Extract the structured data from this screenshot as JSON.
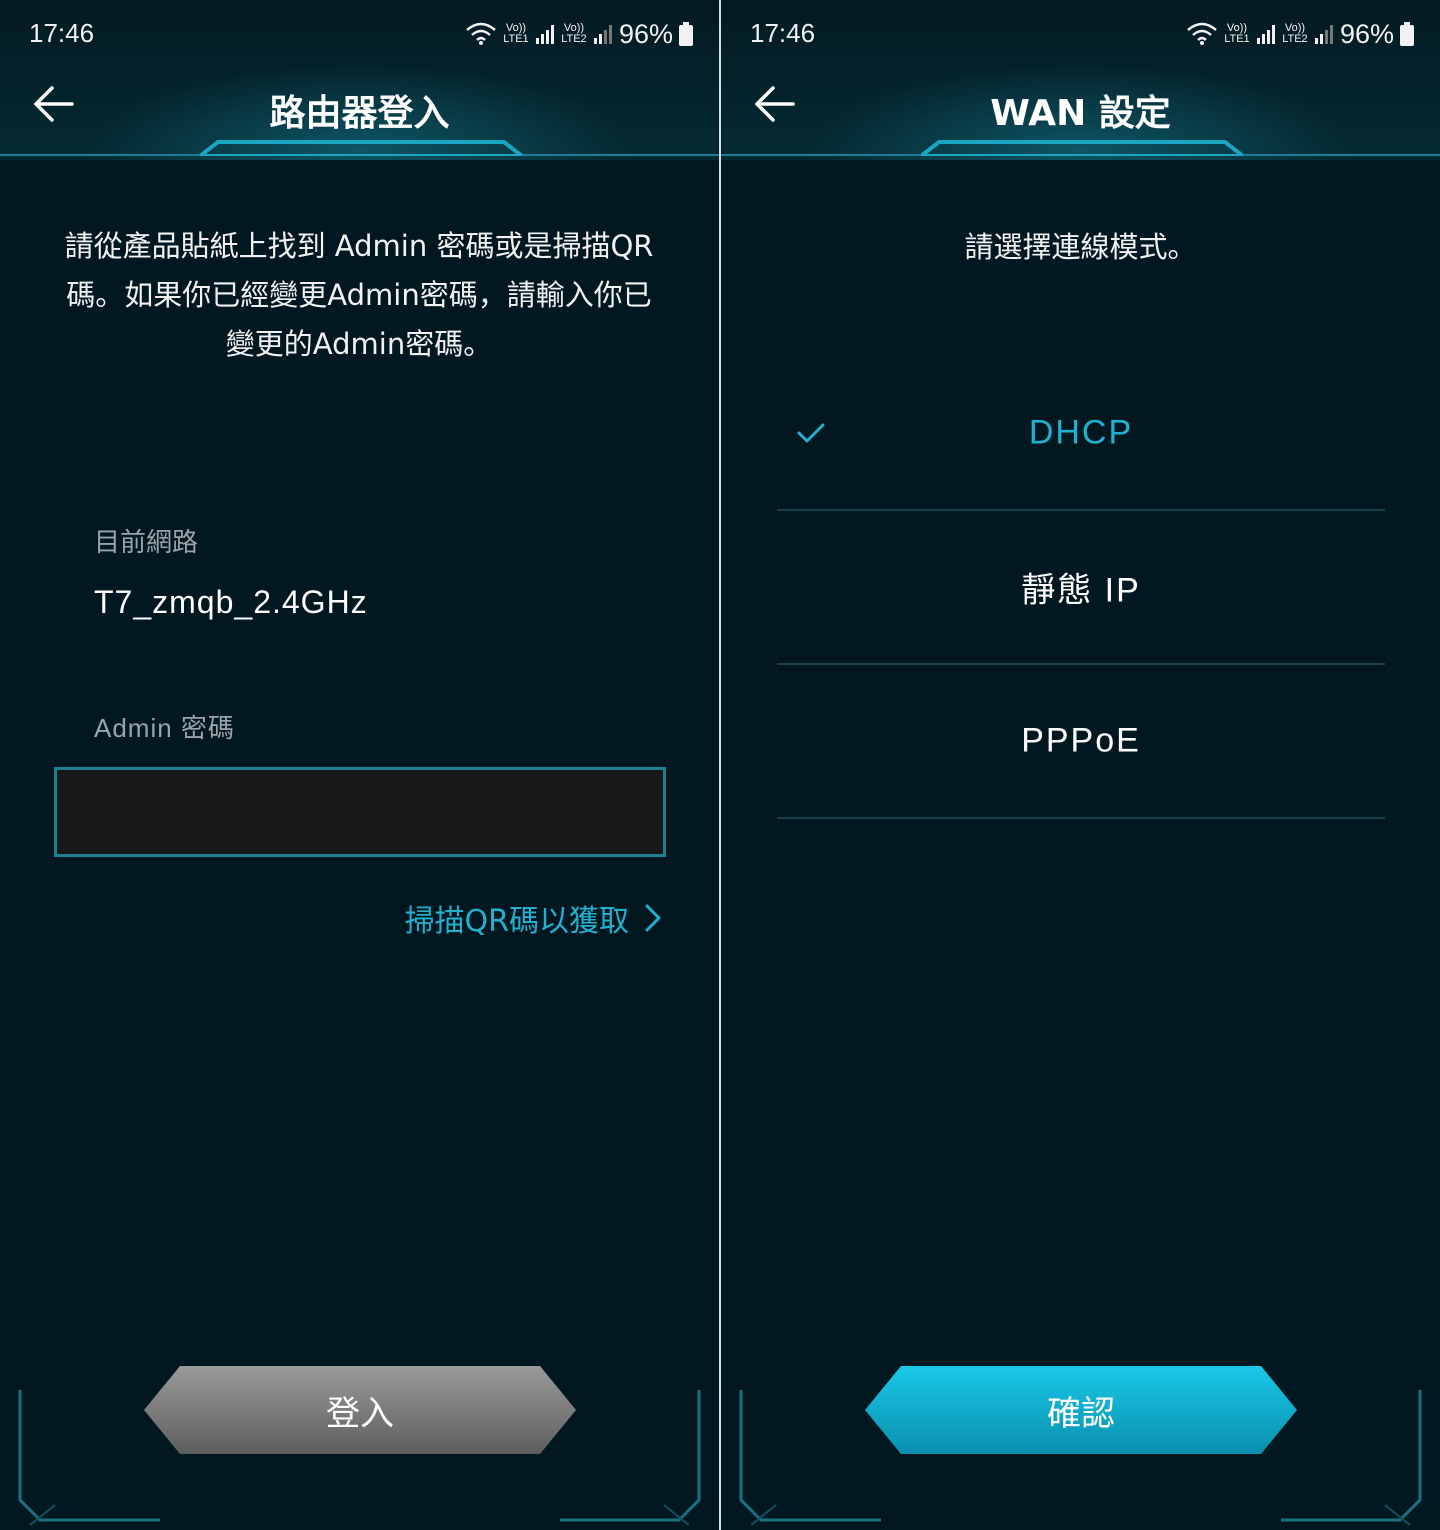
{
  "left": {
    "status": {
      "time": "17:46",
      "battery": "96%",
      "sim1": "Vo)) LTE1",
      "sim2": "Vo)) LTE2"
    },
    "title": "路由器登入",
    "intro": "請從產品貼紙上找到 Admin 密碼或是掃描QR碼。如果你已經變更Admin密碼，請輸入你已變更的Admin密碼。",
    "network_label": "目前網路",
    "network_value": "T7_zmqb_2.4GHz",
    "password_label": "Admin 密碼",
    "password_value": "",
    "qr_link": "掃描QR碼以獲取",
    "login_button": "登入"
  },
  "right": {
    "status": {
      "time": "17:46",
      "battery": "96%",
      "sim1": "Vo)) LTE1",
      "sim2": "Vo)) LTE2"
    },
    "title": "WAN 設定",
    "prompt": "請選擇連線模式。",
    "options": [
      {
        "label": "DHCP",
        "selected": true
      },
      {
        "label": "靜態 IP",
        "selected": false
      },
      {
        "label": "PPPoE",
        "selected": false
      }
    ],
    "confirm_button": "確認"
  },
  "colors": {
    "background": "#021820",
    "accent": "#22b0d0",
    "line": "#1a7f93",
    "grey_button": "#7a7a7a"
  },
  "icons": {
    "back": "back-arrow-icon",
    "chevron": "chevron-right-icon",
    "check": "check-icon"
  }
}
